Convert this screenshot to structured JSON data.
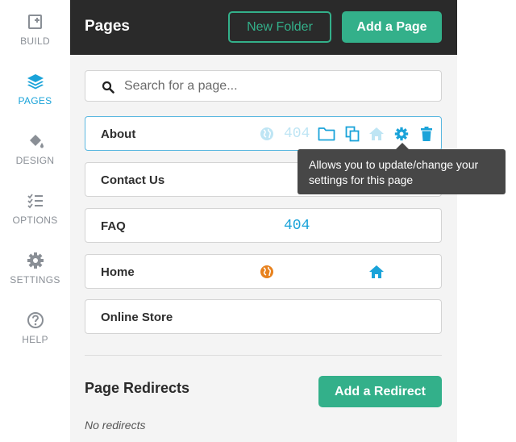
{
  "sidebar": {
    "items": [
      {
        "label": "BUILD",
        "icon": "build-icon"
      },
      {
        "label": "PAGES",
        "icon": "layers-icon",
        "active": true
      },
      {
        "label": "DESIGN",
        "icon": "paint-bucket-icon"
      },
      {
        "label": "OPTIONS",
        "icon": "checklist-icon"
      },
      {
        "label": "SETTINGS",
        "icon": "gear-icon"
      },
      {
        "label": "HELP",
        "icon": "question-circle-icon"
      }
    ]
  },
  "header": {
    "title": "Pages",
    "new_folder_label": "New Folder",
    "add_page_label": "Add a Page"
  },
  "search": {
    "placeholder": "Search for a page...",
    "value": ""
  },
  "pages": [
    {
      "name": "About",
      "badge": "404"
    },
    {
      "name": "Contact Us"
    },
    {
      "name": "FAQ",
      "badge": "404"
    },
    {
      "name": "Home"
    },
    {
      "name": "Online Store"
    }
  ],
  "tooltip": {
    "text": "Allows you to update/change your settings for this page"
  },
  "redirects": {
    "title": "Page Redirects",
    "add_label": "Add a Redirect",
    "empty_text": "No redirects"
  },
  "colors": {
    "accent_green": "#33b08a",
    "accent_blue": "#1aa3d9",
    "globe_orange": "#e8821e",
    "header_dark": "#2a2a2a"
  }
}
